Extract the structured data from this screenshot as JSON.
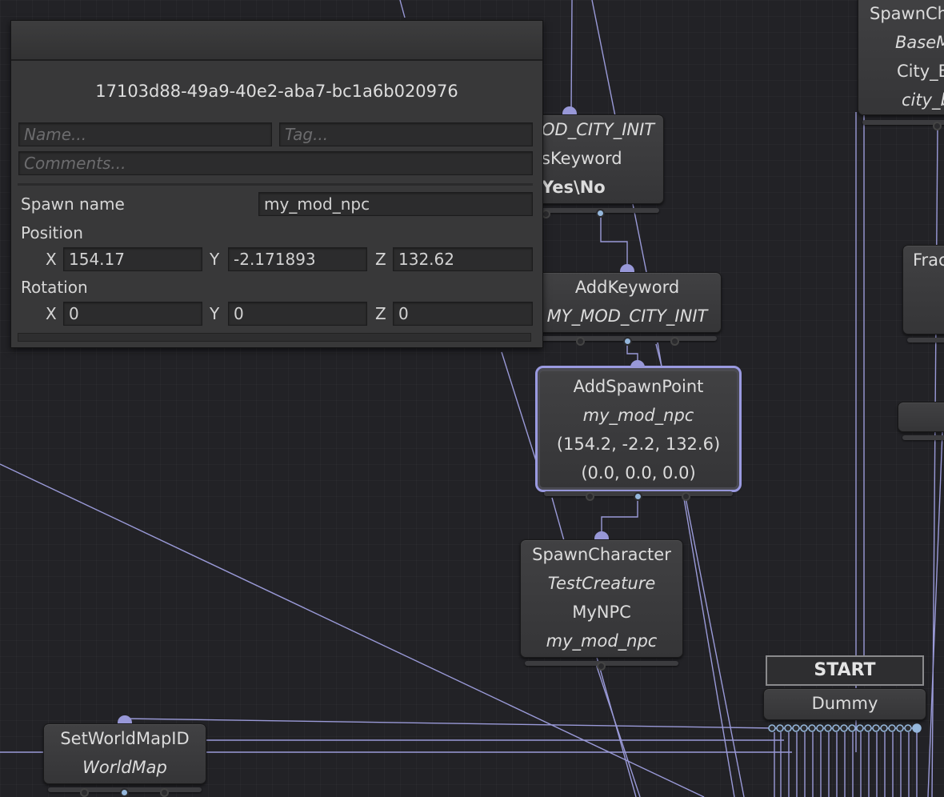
{
  "colors": {
    "wire": "#9a9ad8",
    "port_out": "#95b7dc",
    "selection": "#9a9ae0"
  },
  "inspector": {
    "uuid": "17103d88-49a9-40e2-aba7-bc1a6b020976",
    "name_placeholder": "Name...",
    "tag_placeholder": "Tag...",
    "comments_placeholder": "Comments...",
    "spawn_name_label": "Spawn name",
    "spawn_name_value": "my_mod_npc",
    "position_label": "Position",
    "rotation_label": "Rotation",
    "x_label": "X",
    "y_label": "Y",
    "z_label": "Z",
    "position": {
      "x": "154.17",
      "y": "-2.171893",
      "z": "132.62"
    },
    "rotation": {
      "x": "0",
      "y": "0",
      "z": "0"
    }
  },
  "nodes": {
    "has_keyword": {
      "line1": "OD_CITY_INIT",
      "line2": "sKeyword",
      "line3": "Yes\\No"
    },
    "add_keyword": {
      "title": "AddKeyword",
      "line2": "MY_MOD_CITY_INIT"
    },
    "add_spawn_point": {
      "title": "AddSpawnPoint",
      "line2": "my_mod_npc",
      "line3": "(154.2, -2.2, 132.6)",
      "line4": "(0.0, 0.0, 0.0)"
    },
    "spawn_character": {
      "title": "SpawnCharacter",
      "line2": "TestCreature",
      "line3": "MyNPC",
      "line4": "my_mod_npc"
    },
    "spawn_character_right": {
      "title": "SpawnCh",
      "line2": "BaseM",
      "line3": "City_E",
      "line4": "city_b"
    },
    "frac": {
      "title": "Frac"
    },
    "start": {
      "label": "START"
    },
    "dummy": {
      "title": "Dummy"
    },
    "set_world_map": {
      "title": "SetWorldMapID",
      "line2": "WorldMap"
    }
  }
}
